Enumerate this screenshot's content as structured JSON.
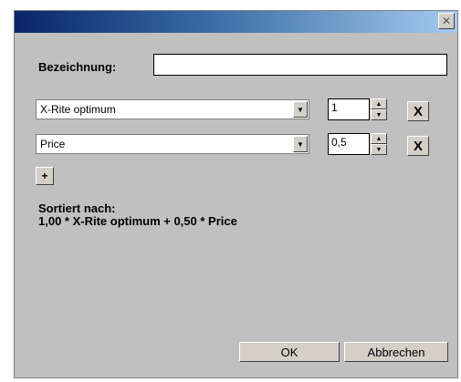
{
  "titlebar": {
    "close_glyph": "✕"
  },
  "form": {
    "name_label": "Bezeichnung:",
    "name_value": ""
  },
  "criteria": [
    {
      "field": "X-Rite optimum",
      "weight": "1",
      "remove_label": "X"
    },
    {
      "field": "Price",
      "weight": "0,5",
      "remove_label": "X"
    }
  ],
  "add_button_label": "+",
  "sort": {
    "label": "Sortiert nach:",
    "formula": "1,00 * X-Rite optimum + 0,50 * Price"
  },
  "buttons": {
    "ok": "OK",
    "cancel": "Abbrechen"
  },
  "icons": {
    "dropdown": "chevron-down-icon",
    "spin_up": "triangle-up-icon",
    "spin_down": "triangle-down-icon"
  }
}
